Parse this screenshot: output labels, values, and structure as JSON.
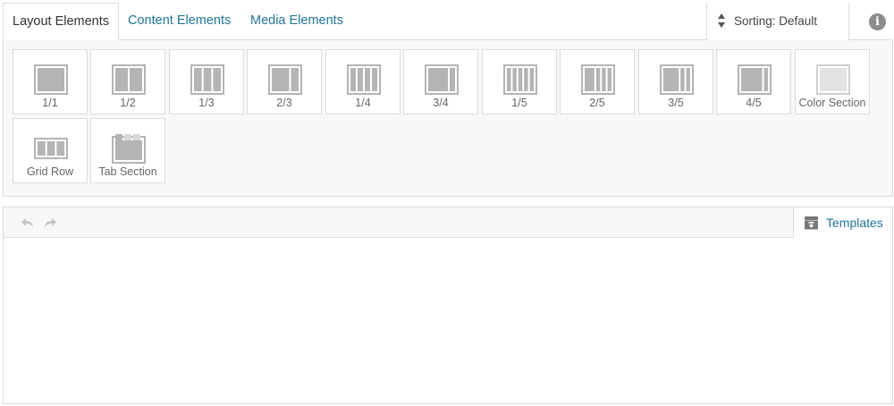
{
  "tabs": {
    "layout": "Layout Elements",
    "content": "Content Elements",
    "media": "Media Elements"
  },
  "sorting": {
    "label": "Sorting: Default"
  },
  "info": {
    "glyph": "i"
  },
  "palette": {
    "items": [
      {
        "label": "1/1",
        "icon": "column-1-1-icon"
      },
      {
        "label": "1/2",
        "icon": "column-1-2-icon"
      },
      {
        "label": "1/3",
        "icon": "column-1-3-icon"
      },
      {
        "label": "2/3",
        "icon": "column-2-3-icon"
      },
      {
        "label": "1/4",
        "icon": "column-1-4-icon"
      },
      {
        "label": "3/4",
        "icon": "column-3-4-icon"
      },
      {
        "label": "1/5",
        "icon": "column-1-5-icon"
      },
      {
        "label": "2/5",
        "icon": "column-2-5-icon"
      },
      {
        "label": "3/5",
        "icon": "column-3-5-icon"
      },
      {
        "label": "4/5",
        "icon": "column-4-5-icon"
      },
      {
        "label": "Color Section",
        "icon": "color-section-icon"
      },
      {
        "label": "Grid Row",
        "icon": "grid-row-icon"
      },
      {
        "label": "Tab Section",
        "icon": "tab-section-icon"
      }
    ]
  },
  "editor": {
    "templates_label": "Templates"
  },
  "colors": {
    "link": "#21759b",
    "border": "#dcdcdc",
    "icon_fill": "#b4b4b4"
  }
}
